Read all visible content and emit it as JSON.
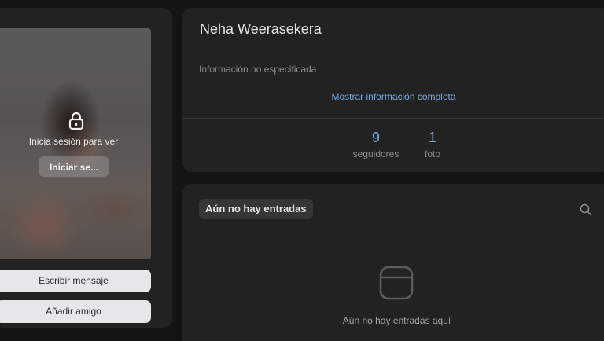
{
  "profile": {
    "name": "Neha Weerasekera",
    "photo_overlay": {
      "login_prompt": "Inicia sesión para ver",
      "login_button": "Iniciar se..."
    },
    "actions": {
      "write_message": "Escribir mensaje",
      "add_friend": "Añadir amigo"
    },
    "info": {
      "not_specified": "Información no especificada",
      "show_full": "Mostrar información completa"
    },
    "stats": [
      {
        "count": "9",
        "label": "seguidores"
      },
      {
        "count": "1",
        "label": "foto"
      }
    ]
  },
  "posts": {
    "tab_label": "Aún no hay entradas",
    "empty_message": "Aún no hay entradas aquí"
  },
  "colors": {
    "page_bg": "#141414",
    "card_bg": "#222222",
    "accent": "#71aaeb",
    "muted_text": "#8a8c8f"
  },
  "icons": [
    "lock-icon",
    "search-icon",
    "empty-posts-icon"
  ]
}
